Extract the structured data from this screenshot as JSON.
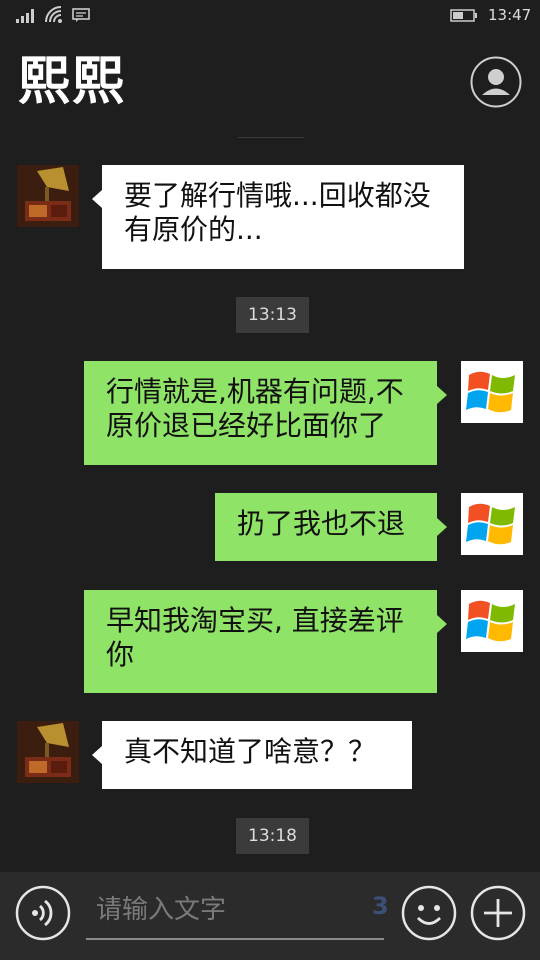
{
  "status_bar": {
    "time": "13:47"
  },
  "header": {
    "title": "熙熙"
  },
  "messages": [
    {
      "text": "要了解行情哦...回收都没有原价的..."
    },
    {
      "time": "13:13"
    },
    {
      "text": "行情就是,机器有问题,不原价退已经好比面你了"
    },
    {
      "text": "扔了我也不退"
    },
    {
      "text": "早知我淘宝买, 直接差评你"
    },
    {
      "text": "真不知道了啥意？？"
    },
    {
      "time": "13:18"
    }
  ],
  "input_bar": {
    "placeholder": "请输入文字",
    "watermark": "3"
  },
  "icons": {
    "signal": "signal-icon",
    "wifi": "wifi-icon",
    "message": "message-icon",
    "battery": "battery-icon",
    "profile": "person-icon",
    "voice": "voice-icon",
    "emoji": "emoji-icon",
    "add": "plus-icon"
  },
  "colors": {
    "incoming_bubble": "#ffffff",
    "outgoing_bubble": "#8fe367",
    "background": "#1e1e1e"
  }
}
